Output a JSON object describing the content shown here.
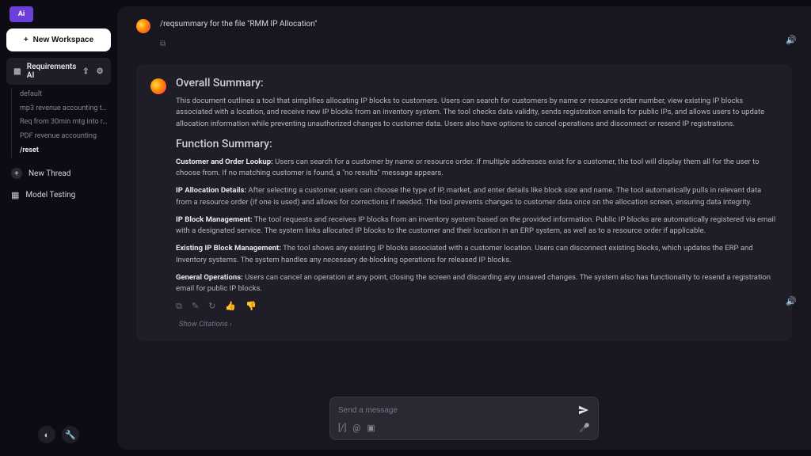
{
  "app": {
    "badge": "Ai"
  },
  "sidebar": {
    "new_workspace": "New Workspace",
    "workspace_label": "Requirements AI",
    "items": [
      {
        "label": "default"
      },
      {
        "label": "mp3 revenue accounting te..."
      },
      {
        "label": "Req from 30min mtg into r..."
      },
      {
        "label": "PDF revenue accounting"
      },
      {
        "label": "/reset",
        "bold": true
      }
    ],
    "new_thread": "New Thread",
    "model_testing": "Model Testing"
  },
  "query": {
    "text": "/reqsummary for the file \"RMM IP Allocation\""
  },
  "response": {
    "h_overall": "Overall Summary:",
    "overall_p": "This document outlines a tool that simplifies allocating IP blocks to customers. Users can search for customers by name or resource order number, view existing IP blocks associated with a location, and receive new IP blocks from an inventory system. The tool checks data validity, sends registration emails for public IPs, and allows users to update allocation information while preventing unauthorized changes to customer data. Users also have options to cancel operations and disconnect or resend IP registrations.",
    "h_function": "Function Summary:",
    "sections": [
      {
        "title": "Customer and Order Lookup:",
        "body": "Users can search for a customer by name or resource order. If multiple addresses exist for a customer, the tool will display them all for the user to choose from. If no matching customer is found, a \"no results\" message appears."
      },
      {
        "title": "IP Allocation Details:",
        "body": "After selecting a customer, users can choose the type of IP, market, and enter details like block size and name. The tool automatically pulls in relevant data from a resource order (if one is used) and allows for corrections if needed. The tool prevents changes to customer data once on the allocation screen, ensuring data integrity."
      },
      {
        "title": "IP Block Management:",
        "body": "The tool requests and receives IP blocks from an inventory system based on the provided information. Public IP blocks are automatically registered via email with a designated service. The system links allocated IP blocks to the customer and their location in an ERP system, as well as to a resource order if applicable."
      },
      {
        "title": "Existing IP Block Management:",
        "body": "The tool shows any existing IP blocks associated with a customer location. Users can disconnect existing blocks, which updates the ERP and Inventory systems. The system handles any necessary de-blocking operations for released IP blocks."
      },
      {
        "title": "General Operations:",
        "body": "Users can cancel an operation at any point, closing the screen and discarding any unsaved changes. The system also has functionality to resend a registration email for public IP blocks."
      }
    ],
    "citations_label": "Show Citations  ›"
  },
  "composer": {
    "placeholder": "Send a message"
  }
}
